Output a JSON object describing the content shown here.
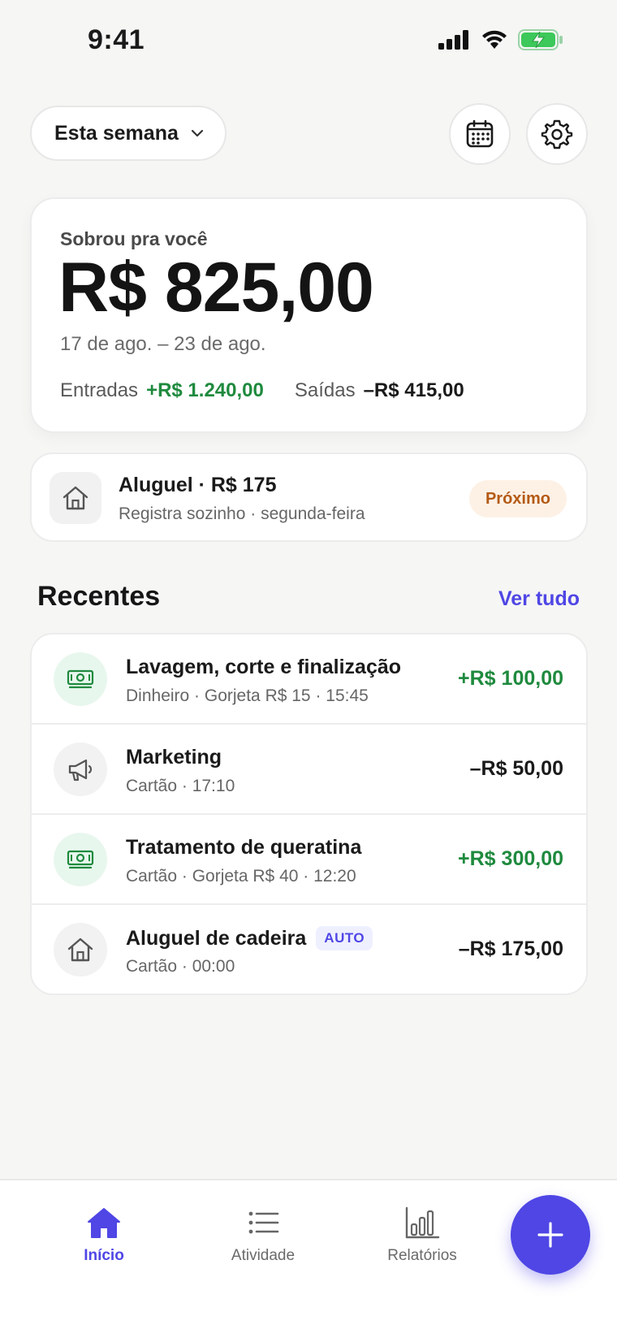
{
  "status_bar": {
    "time": "9:41",
    "icons": [
      "signal-icon",
      "wifi-icon",
      "battery-charging-icon"
    ]
  },
  "header": {
    "period_label": "Esta semana",
    "calendar_icon": "calendar-icon",
    "settings_icon": "gear-icon"
  },
  "summary": {
    "label": "Sobrou pra você",
    "amount": "R$ 825,00",
    "range": "17 de ago. – 23 de ago.",
    "income_label": "Entradas",
    "income_value": "+R$ 1.240,00",
    "expense_label": "Saídas",
    "expense_value": "–R$ 415,00"
  },
  "upcoming": {
    "icon": "home-icon",
    "title": "Aluguel · R$ 175",
    "subtitle": "Registra sozinho · segunda-feira",
    "badge": "Próximo"
  },
  "recent": {
    "title": "Recentes",
    "see_all": "Ver tudo",
    "items": [
      {
        "icon": "cash-icon",
        "title": "Lavagem, corte e finalização",
        "subtitle": "Dinheiro · Gorjeta R$ 15 · 15:45",
        "amount": "+R$ 100,00",
        "badge": ""
      },
      {
        "icon": "megaphone-icon",
        "title": "Marketing",
        "subtitle": "Cartão · 17:10",
        "amount": "–R$ 50,00",
        "badge": ""
      },
      {
        "icon": "cash-icon",
        "title": "Tratamento de queratina",
        "subtitle": "Cartão · Gorjeta R$ 40 · 12:20",
        "amount": "+R$ 300,00",
        "badge": ""
      },
      {
        "icon": "home-icon",
        "title": "Aluguel de cadeira",
        "subtitle": "Cartão · 00:00",
        "amount": "–R$ 175,00",
        "badge": "AUTO"
      }
    ]
  },
  "nav": {
    "home": "Início",
    "activity": "Atividade",
    "reports": "Relatórios",
    "fab_icon": "plus-icon"
  },
  "colors": {
    "accent": "#4f46e5",
    "positive": "#1f8a3e",
    "badge_warm": "#b45a14"
  }
}
